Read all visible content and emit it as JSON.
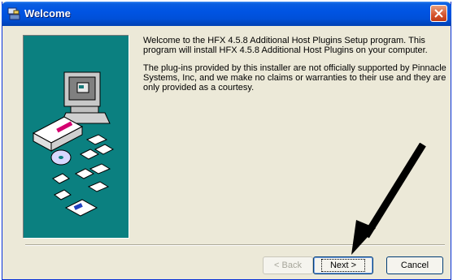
{
  "window": {
    "title": "Welcome"
  },
  "content": {
    "para1": "Welcome to the HFX 4.5.8 Additional Host Plugins Setup program. This program will install HFX 4.5.8 Additional Host Plugins on your computer.",
    "para2": "The plug-ins provided by this installer are not officially supported by Pinnacle Systems, Inc, and we make no claims or warranties to their use and they are only provided as a courtesy."
  },
  "buttons": {
    "back": "< Back",
    "next": "Next >",
    "cancel": "Cancel"
  },
  "colors": {
    "title_bar": "#0054e3",
    "panel": "#0b8080",
    "arrow": "#000000"
  },
  "icons": [
    "setup-icon",
    "close-icon",
    "computer-icon",
    "floppy-icon",
    "cd-icon",
    "pointer-arrow"
  ]
}
